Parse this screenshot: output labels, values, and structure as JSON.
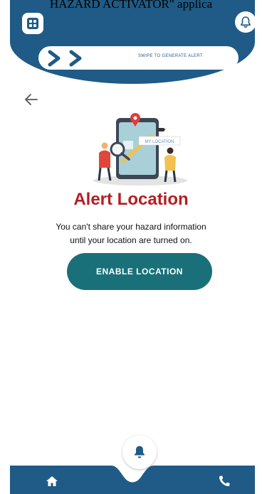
{
  "caption": "HAZARD ACTIVATOR\" applica",
  "header": {
    "swipe_label": "SWIPE TO GENERATE ALERT",
    "menu_icon": "grid-menu-icon",
    "bell_icon": "bell-icon"
  },
  "illustration": {
    "sign_text": "MY LOCATION"
  },
  "main": {
    "title": "Alert Location",
    "description_line1": "You can't share your hazard information",
    "description_line2": "until your location are turned on.",
    "enable_button": "ENABLE LOCATION"
  },
  "nav": {
    "home_icon": "home-icon",
    "alert_icon": "bell-icon",
    "phone_icon": "phone-icon"
  },
  "colors": {
    "primary_blue": "#1f5b86",
    "title_red": "#b51d22",
    "button_teal": "#1a7078"
  }
}
